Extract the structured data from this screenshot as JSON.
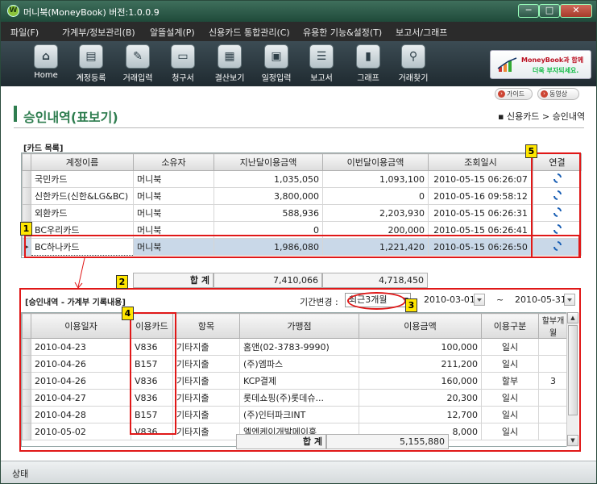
{
  "window": {
    "title": "머니북(MoneyBook) 버전:1.0.0.9",
    "app_icon": "W",
    "buttons": {
      "minimize": "─",
      "maximize": "□",
      "close": "✕"
    }
  },
  "menu": [
    "파일(F)",
    "가계부/정보관리(B)",
    "알뜰설계(P)",
    "신용카드 통합관리(C)",
    "유용한 기능&설정(T)",
    "보고서/그래프"
  ],
  "toolbar": [
    {
      "label": "Home",
      "icon": "home-icon"
    },
    {
      "label": "계정등록",
      "icon": "card-register-icon"
    },
    {
      "label": "거래입력",
      "icon": "edit-icon"
    },
    {
      "label": "청구서",
      "icon": "bill-icon"
    },
    {
      "label": "결산보기",
      "icon": "settlement-icon"
    },
    {
      "label": "일정입력",
      "icon": "calendar-icon"
    },
    {
      "label": "보고서",
      "icon": "report-icon"
    },
    {
      "label": "그래프",
      "icon": "chart-icon"
    },
    {
      "label": "거래찾기",
      "icon": "search-icon"
    }
  ],
  "ad_banner": {
    "line1": "MoneyBook과 함께",
    "line2": "더욱 부자되세요."
  },
  "help": {
    "guide": "가이드",
    "video": "동영상"
  },
  "page": {
    "title": "승인내역(표보기)",
    "breadcrumb": "▪ 신용카드 > 승인내역"
  },
  "card_list": {
    "label": "[카드 목록]",
    "columns": [
      "계정이름",
      "소유자",
      "지난달이용금액",
      "이번달이용금액",
      "조회일시",
      "연결"
    ],
    "rows": [
      [
        "국민카드",
        "머니북",
        "1,035,050",
        "1,093,100",
        "2010-05-15 06:26:07"
      ],
      [
        "신한카드(신한&LG&BC)",
        "머니북",
        "3,800,000",
        "0",
        "2010-05-16 09:58:12"
      ],
      [
        "외환카드",
        "머니북",
        "588,936",
        "2,203,930",
        "2010-05-15 06:26:31"
      ],
      [
        "BC우리카드",
        "머니북",
        "0",
        "200,000",
        "2010-05-15 06:26:41"
      ],
      [
        "BC하나카드",
        "머니북",
        "1,986,080",
        "1,221,420",
        "2010-05-15 06:26:50"
      ]
    ],
    "total_label": "합 계",
    "total_last_month": "7,410,066",
    "total_this_month": "4,718,450"
  },
  "approvals": {
    "label": "[승인내역 - 가계부 기록내용]",
    "period_label": "기간변경 :",
    "period_value": "최근3개월",
    "date_from": "2010-03-01",
    "date_sep": "~",
    "date_to": "2010-05-31",
    "columns": [
      "이용일자",
      "이용카드",
      "항목",
      "가맹점",
      "이용금액",
      "이용구분",
      "할부개월"
    ],
    "rows": [
      [
        "2010-04-23",
        "V836",
        "기타지출",
        "홈앤(02-3783-9990)",
        "100,000",
        "일시",
        ""
      ],
      [
        "2010-04-26",
        "B157",
        "기타지출",
        "(주)엠파스",
        "211,200",
        "일시",
        ""
      ],
      [
        "2010-04-26",
        "V836",
        "기타지출",
        "KCP결제",
        "160,000",
        "할부",
        "3"
      ],
      [
        "2010-04-27",
        "V836",
        "기타지출",
        "롯데쇼핑(주)롯데슈...",
        "20,300",
        "일시",
        ""
      ],
      [
        "2010-04-28",
        "B157",
        "기타지출",
        "(주)인터파크INT",
        "12,700",
        "일시",
        ""
      ],
      [
        "2010-05-02",
        "V836",
        "기타지출",
        "엘엔케이개발메이홍",
        "8,000",
        "일시",
        ""
      ]
    ],
    "total_label": "합 계",
    "total_amount": "5,155,880"
  },
  "annotations": [
    "1",
    "2",
    "3",
    "4",
    "5"
  ],
  "status": "상태",
  "colors": {
    "accent": "#2e7d4f",
    "annotation": "#e01818",
    "badge": "#ffe600",
    "selected_row": "#c9d8e8"
  }
}
